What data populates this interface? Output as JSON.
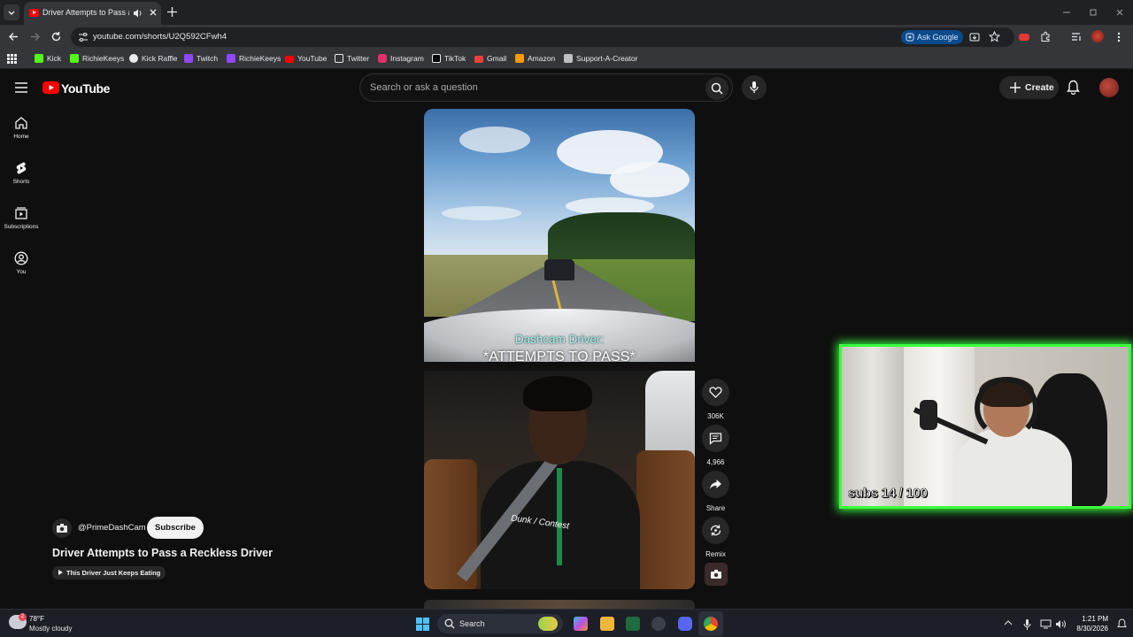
{
  "browser": {
    "tab_title": "Driver Attempts to Pass a Reckless Driver",
    "url": "youtube.com/shorts/U2Q592CFwh4",
    "ask_google": "Ask Google",
    "bookmarks": [
      {
        "label": "Kick",
        "color": "#53fc18"
      },
      {
        "label": "RichieKeeys",
        "color": "#53fc18"
      },
      {
        "label": "Kick Raffle",
        "color": "#e8eaed"
      },
      {
        "label": "Twitch",
        "color": "#9146ff"
      },
      {
        "label": "RichieKeeys",
        "color": "#9146ff"
      },
      {
        "label": "YouTube",
        "color": "#ff0000"
      },
      {
        "label": "Twitter",
        "color": "#e8eaed"
      },
      {
        "label": "Instagram",
        "color": "#e1306c"
      },
      {
        "label": "TikTok",
        "color": "#e8eaed"
      },
      {
        "label": "Gmail",
        "color": "#ea4335"
      },
      {
        "label": "Amazon",
        "color": "#ff9900"
      },
      {
        "label": "Support-A-Creator",
        "color": "#bdc1c6"
      }
    ]
  },
  "youtube": {
    "logo_text": "YouTube",
    "search_placeholder": "Search or ask a question",
    "create_label": "Create",
    "sidebar": [
      {
        "label": "Home",
        "icon": "home-icon"
      },
      {
        "label": "Shorts",
        "icon": "shorts-icon"
      },
      {
        "label": "Subscriptions",
        "icon": "subscriptions-icon"
      },
      {
        "label": "You",
        "icon": "you-icon"
      }
    ],
    "short": {
      "caption_line1": "Dashcam Driver:",
      "caption_line2": "*ATTEMPTS TO PASS*",
      "shirt_text": "Dunk / Contest",
      "likes": "306K",
      "comments": "4,966",
      "share_label": "Share",
      "remix_label": "Remix",
      "channel": "@PrimeDashCam",
      "subscribe_label": "Subscribe",
      "title": "Driver Attempts to Pass a Reckless Driver",
      "suggestion": "This Driver Just Keeps Eating"
    }
  },
  "overlay": {
    "subs_text": "subs 14 / 100",
    "border_color": "#39ff3d"
  },
  "taskbar": {
    "temperature": "78°F",
    "weather": "Mostly cloudy",
    "weather_badge": "2",
    "search_label": "Search",
    "time": "1:21 PM",
    "date": "8/30/2026"
  }
}
